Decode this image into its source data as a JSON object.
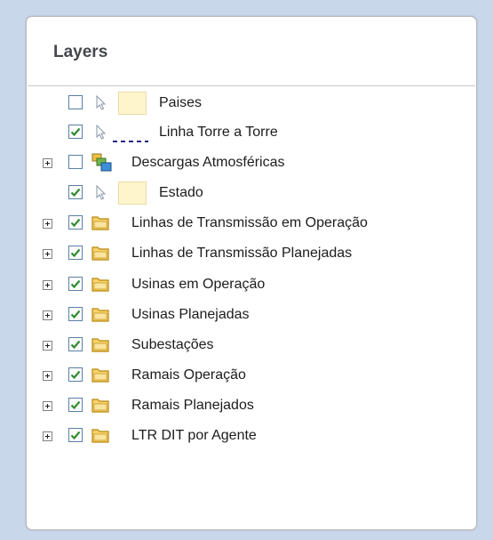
{
  "panel": {
    "title": "Layers"
  },
  "layers": [
    {
      "label": "Paises",
      "checked": false,
      "expandable": false,
      "icon": "polygon-swatch-icon"
    },
    {
      "label": "Linha Torre a Torre",
      "checked": true,
      "expandable": false,
      "icon": "dashed-line-symbol-icon"
    },
    {
      "label": "Descargas Atmosféricas",
      "checked": false,
      "expandable": true,
      "icon": "layer-group-icon"
    },
    {
      "label": "Estado",
      "checked": true,
      "expandable": false,
      "icon": "polygon-swatch-icon"
    },
    {
      "label": "Linhas de Transmissão em Operação",
      "checked": true,
      "expandable": true,
      "icon": "folder-icon"
    },
    {
      "label": "Linhas de Transmissão Planejadas",
      "checked": true,
      "expandable": true,
      "icon": "folder-icon"
    },
    {
      "label": "Usinas em Operação",
      "checked": true,
      "expandable": true,
      "icon": "folder-icon"
    },
    {
      "label": "Usinas Planejadas",
      "checked": true,
      "expandable": true,
      "icon": "folder-icon"
    },
    {
      "label": "Subestações",
      "checked": true,
      "expandable": true,
      "icon": "folder-icon"
    },
    {
      "label": "Ramais Operação",
      "checked": true,
      "expandable": true,
      "icon": "folder-icon"
    },
    {
      "label": "Ramais Planejados",
      "checked": true,
      "expandable": true,
      "icon": "folder-icon"
    },
    {
      "label": "LTR DIT por Agente",
      "checked": true,
      "expandable": true,
      "icon": "folder-icon"
    }
  ],
  "colors": {
    "background": "#c9d7ea",
    "checkmark": "#2e8b2e",
    "checkbox_border": "#5b7fa6",
    "swatch_fill": "#fff5cc",
    "folder": "#e8b93a",
    "dash_line": "#1a237e"
  }
}
